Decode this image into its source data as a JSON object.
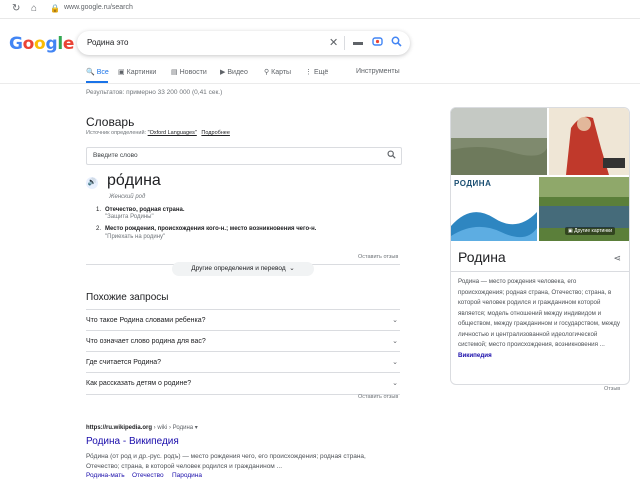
{
  "browser": {
    "url": "www.google.ru/search"
  },
  "logo": {
    "letters": [
      "G",
      "o",
      "o",
      "g",
      "l",
      "e"
    ],
    "colors": [
      "#4285f4",
      "#ea4335",
      "#fbbc05",
      "#4285f4",
      "#34a853",
      "#ea4335"
    ]
  },
  "search": {
    "query": "Родина это"
  },
  "tabs": [
    {
      "icon": "🔍",
      "label": "Все"
    },
    {
      "icon": "▣",
      "label": "Картинки"
    },
    {
      "icon": "▤",
      "label": "Новости"
    },
    {
      "icon": "▶",
      "label": "Видео"
    },
    {
      "icon": "⚲",
      "label": "Карты"
    },
    {
      "icon": "⋮",
      "label": "Ещё"
    }
  ],
  "tools_label": "Инструменты",
  "stats": "Результатов: примерно 33 200 000 (0,41 сек.)",
  "dictionary": {
    "title": "Словарь",
    "source_prefix": "Источник определений: ",
    "source_link": "\"Oxford Languages\"",
    "source_more": "Подробнее",
    "input_placeholder": "Введите слово",
    "word": "ро́дина",
    "part_of_speech": "Женский род",
    "definitions": [
      {
        "num": "1.",
        "text": "Отечество, родная страна.",
        "example": "\"Защита Родины\""
      },
      {
        "num": "2.",
        "text": "Место рождения, происхождения кого-н.; место возникновения чего-н.",
        "example": "\"Приехать на родину\""
      }
    ],
    "feedback": "Оставить отзыв",
    "more_button": "Другие определения и перевод"
  },
  "related": {
    "title": "Похожие запросы",
    "questions": [
      "Что такое Родина словами ребенка?",
      "Что означает слово родина для вас?",
      "Где считается Родина?",
      "Как рассказать детям о родине?"
    ],
    "feedback": "Оставить отзыв"
  },
  "result": {
    "url_main": "https://ru.wikipedia.org",
    "url_path": " › wiki › Родина ▾",
    "title": "Родина - Википедия",
    "snippet": "Ро́дина (от род и др.-рус. родъ) — место рождения чего, его происхождения; родная страна, Отечество; страна, в которой человек родился и гражданином ...",
    "sitelinks": [
      "Родина-мать",
      "Отечество",
      "Пародина"
    ]
  },
  "knowledge_panel": {
    "title": "Родина",
    "more_images": "Другие картинки",
    "image_caption": "РОДИНА",
    "description": "Родина — место рождения человека, его происхождения; родная страна, Отечество; страна, в которой человек родился и гражданином которой является; модель отношений между индивидом и обществом, между гражданином и государством, между личностью и централизованной идеологической системой; место происхождения, возникновения ...",
    "wiki_link": "Википедия",
    "feedback": "Отзыв"
  }
}
